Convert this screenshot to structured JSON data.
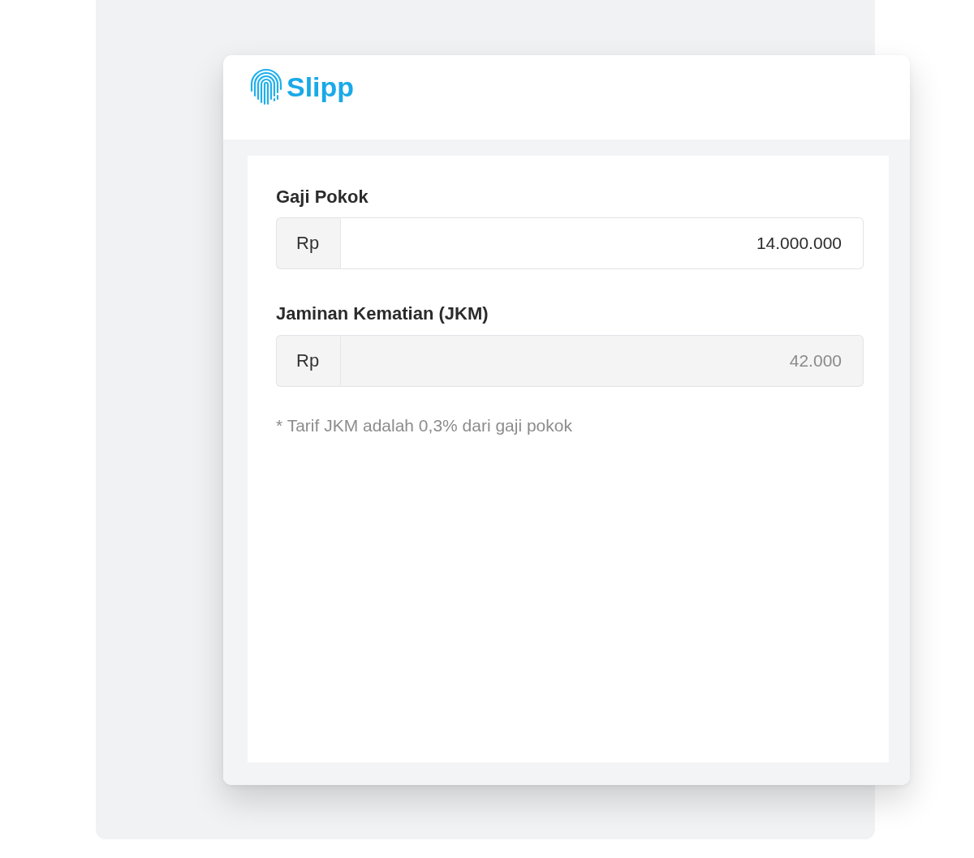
{
  "header": {
    "logo_text": "Slipp"
  },
  "form": {
    "fields": [
      {
        "label": "Gaji Pokok",
        "prefix": "Rp",
        "value": "14.000.000",
        "disabled": false
      },
      {
        "label": "Jaminan Kematian (JKM)",
        "prefix": "Rp",
        "value": "42.000",
        "disabled": true
      }
    ],
    "note": "* Tarif JKM adalah 0,3% dari gaji pokok"
  }
}
